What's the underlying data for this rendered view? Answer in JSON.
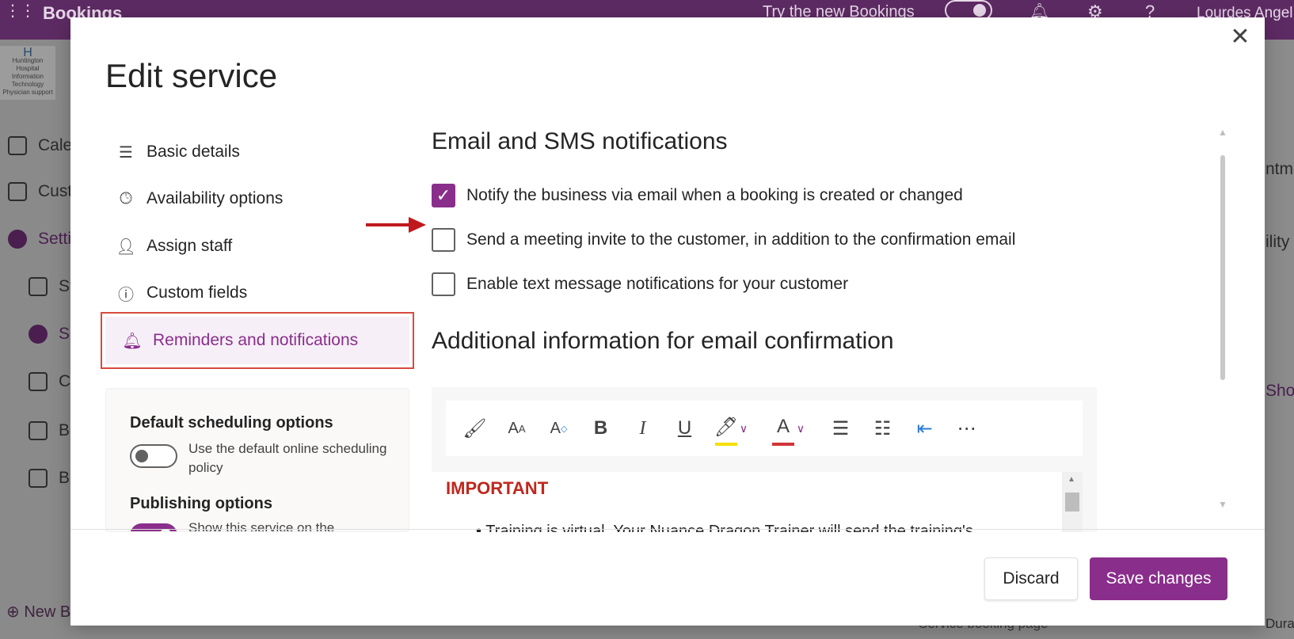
{
  "topbar": {
    "app_title": "Bookings",
    "try_new_label": "Try the new Bookings",
    "user_name": "Lourdes Angel"
  },
  "logo": {
    "line1": "Huntington",
    "line2": "Hospital",
    "line3": "Information Technology",
    "line4": "Physician support"
  },
  "leftnav": {
    "items": [
      {
        "label": "Cale"
      },
      {
        "label": "Cust"
      },
      {
        "label": "Setti"
      },
      {
        "label": "St"
      },
      {
        "label": "Se"
      },
      {
        "label": "C"
      },
      {
        "label": "Bc"
      },
      {
        "label": "B"
      }
    ],
    "new_label": "New B"
  },
  "right_peek": {
    "t1": "ntm",
    "t2": "ility",
    "t3": "Shov",
    "t4": "Duratio",
    "bottom_text": "Service booking page"
  },
  "modal": {
    "title": "Edit service",
    "nav": [
      {
        "label": "Basic details"
      },
      {
        "label": "Availability options"
      },
      {
        "label": "Assign staff"
      },
      {
        "label": "Custom fields"
      },
      {
        "label": "Reminders and notifications"
      }
    ],
    "scheduling": {
      "default_heading": "Default scheduling options",
      "default_desc": "Use the default online scheduling policy",
      "publishing_heading": "Publishing options",
      "publishing_desc": "Show this service on the"
    },
    "notifications": {
      "heading": "Email and SMS notifications",
      "options": [
        {
          "label": "Notify the business via email when a booking is created or changed",
          "checked": true
        },
        {
          "label": "Send a meeting invite to the customer, in addition to the confirmation email",
          "checked": false
        },
        {
          "label": "Enable text message notifications for your customer",
          "checked": false
        }
      ]
    },
    "additional": {
      "heading": "Additional information for email confirmation",
      "important_label": "IMPORTANT",
      "body_text": "Training is virtual. Your Nuance Dragon Trainer will send the training's"
    },
    "footer": {
      "discard_label": "Discard",
      "save_label": "Save changes"
    }
  },
  "colors": {
    "brand": "#8a2e8c",
    "topbar": "#5d2b63",
    "highlight_border": "#d9493f",
    "important": "#c0271d",
    "arrow": "#c0191d"
  }
}
